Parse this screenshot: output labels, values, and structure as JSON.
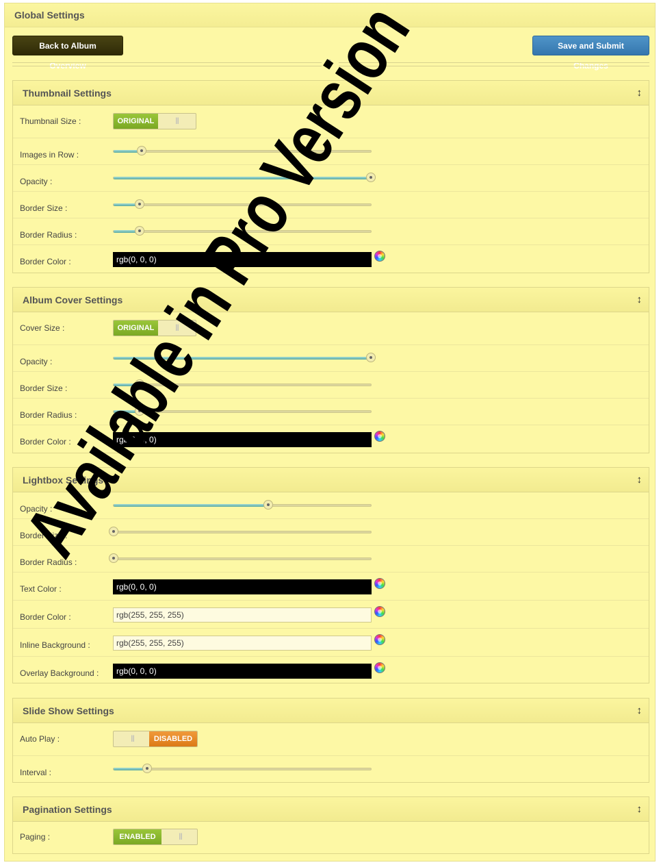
{
  "global": {
    "title": "Global Settings",
    "back_button": "Back to Album Overview",
    "save_button": "Save and Submit Changes",
    "divider_glyph": "§",
    "toggle_glyph": "↕"
  },
  "watermark": "Available in Pro Version",
  "thumbnail": {
    "title": "Thumbnail Settings",
    "size_label": "Thumbnail Size :",
    "size_value": "ORIGINAL",
    "images_in_row_label": "Images in Row :",
    "images_in_row_level": 0.11,
    "opacity_label": "Opacity :",
    "opacity_level": 1.0,
    "border_size_label": "Border Size :",
    "border_size_level": 0.1,
    "border_radius_label": "Border Radius :",
    "border_radius_level": 0.1,
    "border_color_label": "Border Color :",
    "border_color_value": "rgb(0, 0, 0)"
  },
  "album_cover": {
    "title": "Album Cover Settings",
    "size_label": "Cover Size :",
    "size_value": "ORIGINAL",
    "opacity_label": "Opacity :",
    "opacity_level": 1.0,
    "border_size_label": "Border Size :",
    "border_size_level": 0.1,
    "border_radius_label": "Border Radius :",
    "border_radius_level": 0.1,
    "border_color_label": "Border Color :",
    "border_color_value": "rgb(0, 0, 0)"
  },
  "lightbox": {
    "title": "Lightbox Settings",
    "opacity_label": "Opacity :",
    "opacity_level": 0.6,
    "border_size_label": "Border Size :",
    "border_size_level": 0.0,
    "border_radius_label": "Border Radius :",
    "border_radius_level": 0.0,
    "text_color_label": "Text Color :",
    "text_color_value": "rgb(0, 0, 0)",
    "border_color_label": "Border Color :",
    "border_color_value": "rgb(255, 255, 255)",
    "inline_bg_label": "Inline Background :",
    "inline_bg_value": "rgb(255, 255, 255)",
    "overlay_bg_label": "Overlay Background :",
    "overlay_bg_value": "rgb(0, 0, 0)"
  },
  "slideshow": {
    "title": "Slide Show Settings",
    "autoplay_label": "Auto Play :",
    "autoplay_value": "DISABLED",
    "interval_label": "Interval :",
    "interval_level": 0.13
  },
  "pagination": {
    "title": "Pagination Settings",
    "paging_label": "Paging :",
    "paging_value": "ENABLED"
  },
  "colors": {
    "panel_bg": "#fdf8a5",
    "switch_on": "#8ab52d",
    "switch_off": "#e4872a",
    "save_button": "#4186bd",
    "back_button": "#3c360d"
  }
}
